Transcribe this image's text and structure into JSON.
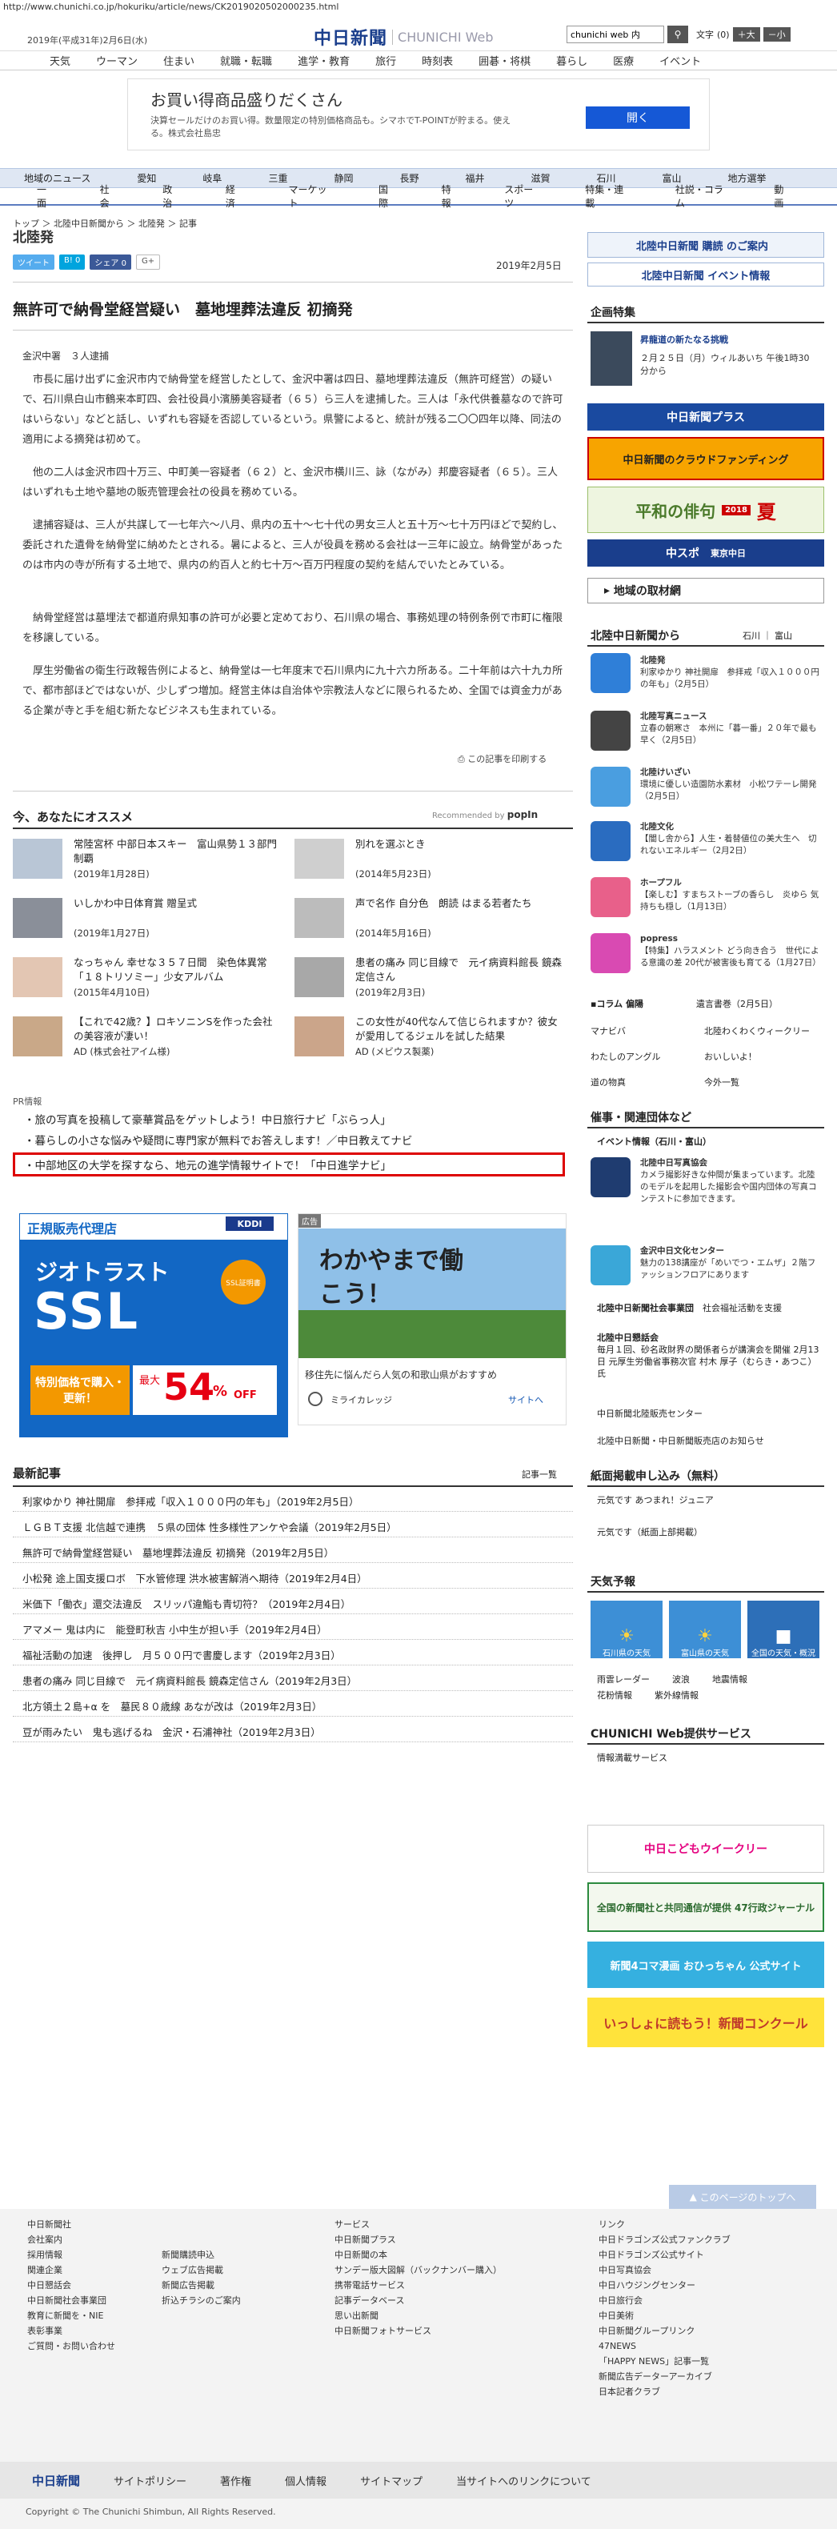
{
  "url": "http://www.chunichi.co.jp/hokuriku/article/news/CK2019020502000235.html",
  "header": {
    "date": "2019年(平成31年)2月6日(水)",
    "logo": "中日新聞",
    "logo_sub": "CHUNICHI Web",
    "search_value": "chunichi web 内",
    "font_label": "文字",
    "font_size": "(0)",
    "font_large": "＋大",
    "font_small": "－小"
  },
  "topnav": [
    "天気",
    "ウーマン",
    "住まい",
    "就職・転職",
    "進学・教育",
    "旅行",
    "時刻表",
    "囲碁・将棋",
    "暮らし",
    "医療",
    "イベント"
  ],
  "top_ad": {
    "title": "お買い得商品盛りだくさん",
    "desc": "決算セールだけのお買い得。数量限定の特別価格商品も。シマホでT-POINTが貯まる。使える。株式会社島忠",
    "btn": "開く"
  },
  "catnav1": [
    "地域のニュース",
    "愛知",
    "岐阜",
    "三重",
    "静岡",
    "長野",
    "福井",
    "滋賀",
    "石川",
    "富山",
    "地方選挙"
  ],
  "catnav2": [
    "一面",
    "社会",
    "政治",
    "経済",
    "マーケット",
    "国際",
    "特報",
    "スポーツ",
    "特集・連載",
    "社説・コラム",
    "動画"
  ],
  "breadcrumb": "トップ ＞ 北陸中日新聞から ＞ 北陸発 ＞ 記事",
  "section": "北陸発",
  "share": {
    "tweet": "ツイート",
    "b": "B! 0",
    "fb": "シェア 0",
    "g": "G+"
  },
  "article": {
    "date": "2019年2月5日",
    "headline": "無許可で納骨堂経営疑い　墓地埋葬法違反 初摘発",
    "byline": "金沢中署　３人逮捕",
    "p1": "市長に届け出ずに金沢市内で納骨堂を経営したとして、金沢中署は四日、墓地埋葬法違反（無許可経営）の疑いで、石川県白山市鶴来本町四、会社役員小濱勝美容疑者（６５）ら三人を逮捕した。三人は「永代供養墓なので許可はいらない」などと話し、いずれも容疑を否認しているという。県警によると、統計が残る二〇〇四年以降、同法の適用による摘発は初めて。",
    "p2": "他の二人は金沢市四十万三、中町美一容疑者（６２）と、金沢市横川三、詠（ながみ）邦慶容疑者（６５）。三人はいずれも土地や墓地の販売管理会社の役員を務めている。",
    "p3": "逮捕容疑は、三人が共謀して一七年六～八月、県内の五十～七十代の男女三人と五十万～七十万円ほどで契約し、委託された遺骨を納骨堂に納めたとされる。暑によると、三人が役員を務める会社は一三年に設立。納骨堂があったのは市内の寺が所有する土地で、県内の約百人と約七十万～百万円程度の契約を結んでいたとみている。",
    "p4": "納骨堂経営は墓埋法で都道府県知事の許可が必要と定めており、石川県の場合、事務処理の特例条例で市町に権限を移譲している。",
    "p5": "厚生労働省の衛生行政報告例によると、納骨堂は一七年度末で石川県内に九十六カ所ある。二十年前は六十九カ所で、都市部ほどではないが、少しずつ増加。経営主体は自治体や宗教法人などに限られるため、全国では資金力がある企業が寺と手を組む新たなビジネスも生まれている。",
    "print": "この記事を印刷する"
  },
  "recommend": {
    "title": "今、あなたにオススメ",
    "by": "Recommended by",
    "brand": "popIn",
    "items": [
      {
        "title": "常陸宮杯 中部日本スキー　富山県勢１３部門制覇",
        "date": "(2019年1月28日)"
      },
      {
        "title": "別れを選ぶとき",
        "date": "(2014年5月23日)"
      },
      {
        "title": "いしかわ中日体育賞 贈呈式",
        "date": "(2019年1月27日)"
      },
      {
        "title": "声で名作 自分色　朗読 はまる若者たち",
        "date": "(2014年5月16日)"
      },
      {
        "title": "なっちゃん 幸せな３５７日間　染色体異常「１８トリソミー」少女アルバム",
        "date": "(2015年4月10日)"
      },
      {
        "title": "患者の痛み 同じ目線で　元イ病資料館長 鏡森定信さん",
        "date": "(2019年2月3日)"
      },
      {
        "title": "【これで42歳？】ロキソニンSを作った会社の美容液が凄い！",
        "date": "AD (株式会社アイム様)"
      },
      {
        "title": "この女性が40代なんて信じられますか？彼女が愛用してるジェルを試した結果",
        "date": "AD (メビウス製薬)"
      }
    ]
  },
  "pr": {
    "label": "PR情報",
    "items": [
      "旅の写真を投稿して豪華賞品をゲットしよう！中日旅行ナビ「ぶらっ人」",
      "暮らしの小さな悩みや疑問に専門家が無料でお答えします！／中日教えてナビ",
      "中部地区の大学を探すなら、地元の進学情報サイトで！「中日進学ナビ」"
    ]
  },
  "ad_ssl": {
    "vendor": "KDDI",
    "title": "正規販売代理店",
    "brand": "ジオトラスト",
    "ssl": "SSL",
    "badge": "SSL証明書",
    "promo": "特別価格で購入・更新！",
    "max": "最大",
    "pct": "54",
    "unit": "%",
    "off": "OFF"
  },
  "ad_wak": {
    "label": "広告",
    "copy": "わかやまで働こう！",
    "desc": "移住先に悩んだら人気の和歌山県がおすすめ",
    "sponsor": "ミライカレッジ",
    "site": "サイトへ"
  },
  "recent": {
    "title": "最新記事",
    "all": "記事一覧",
    "items": [
      "利家ゆかり 神社開扉　参拝戒「収入１０００円の年も」（2019年2月5日）",
      "ＬＧＢＴ支援 北信越で連携　５県の団体 性多様性アンケや会議（2019年2月5日）",
      "無許可で納骨堂経営疑い　墓地埋葬法違反 初摘発（2019年2月5日）",
      "小松発 途上国支援ロボ　下水管修理 洪水被害解消へ期待（2019年2月4日）",
      "米価下「働衣」還交法違反　スリッパ違鮨も青切符？（2019年2月4日）",
      "アマメー 鬼は内に　能登町秋吉 小中生が担い手（2019年2月4日）",
      "福祉活動の加速　後押し　月５００円で書慶します（2019年2月3日）",
      "患者の痛み 同じ目線で　元イ病資料館長 鏡森定信さん（2019年2月3日）",
      "北方領土２島+α を　墓民８０歳線 あなが改は（2019年2月3日）",
      "豆が雨みたい　鬼も逃げるね　金沢・石浦神社（2019年2月3日）"
    ]
  },
  "side": {
    "subscribe": "北陸中日新聞 購読 のご案内",
    "event": "北陸中日新聞 イベント情報",
    "feature_h": "企画特集",
    "feature_title": "昇龍道の新たなる挑戦",
    "feature_desc": "２月２５日（月）ウィルあいち 午後1時30分から",
    "plus": "中日新聞プラス",
    "crowd": "中日新聞のクラウドファンディング",
    "haiku": "平和の俳句",
    "haiku_year": "2018",
    "haiku_season": "夏",
    "chugai": "中スポ",
    "tokyo": "東京中日",
    "local": "地域の取材網",
    "hokuriku_h": "北陸中日新聞から",
    "hokuriku_links": "石川 ｜ 富山",
    "items": [
      {
        "h": "北陸発",
        "d": "利家ゆかり 神社開扉　参拝戒「収入１０００円の年も」（2月5日）"
      },
      {
        "h": "北陸写真ニュース",
        "d": "立春の朝寒さ　本州に「暮一番」２０年で最も早く（2月5日）"
      },
      {
        "h": "北陸けいざい",
        "d": "環境に優しい造園防水素材　小松ワテーレ開発（2月5日）"
      },
      {
        "h": "北陸文化",
        "d": "【闇し舎から】人生・着替値位の美大生へ　切れないエネルギー（2月2日）"
      },
      {
        "h": "ホープフル",
        "d": "【楽しむ】すまちストーブの香らし　炎ゆら 気持ちも穏し（1月13日）"
      },
      {
        "h": "popress",
        "d": "【特集】ハラスメント どう向き合う　世代による意識の差 20代が被害後も育てる（1月27日）"
      }
    ],
    "cols": [
      "コラム 偏陽",
      "遺言書巻（2月5日）",
      "マナビバ",
      "北陸わくわくウィークリー",
      "わたしのアングル",
      "おいしいよ！",
      "道の物真",
      "今外一覧"
    ],
    "sponsor_h": "催事・関連団体など",
    "sponsor_event": "イベント情報（石川・富山）",
    "sponsors": [
      {
        "h": "北陸中日写真協会",
        "d": "カメラ撮影好きな仲間が集まっています。北陸のモデルを起用した撮影会や国内団体の写真コンテストに参加できます。"
      },
      {
        "h": "金沢中日文化センター",
        "d": "魅力の138講座が「めいでつ・エムザ」２階ファッションフロアにあります"
      },
      {
        "h": "北陸中日新聞社会事業団",
        "d": "社会福祉活動を支援"
      },
      {
        "h": "北陸中日懇話会",
        "d": "毎月１回、砂名政財界の関係者らが講演会を開催 2月13日 元厚生労働省事務次官 村木 厚子（むらき・あつこ）氏"
      },
      {
        "h": "中日新聞北陸販売センター",
        "d": ""
      },
      {
        "h": "北陸中日新聞・中日新聞販売店のお知らせ",
        "d": ""
      }
    ],
    "paper_h": "紙面掲載申し込み（無料）",
    "paper_items": [
      "元気です あつまれ！ジュニア",
      "元気です（紙面上部掲載）"
    ],
    "weather_h": "天気予報",
    "weather": [
      "石川県の天気",
      "富山県の天気",
      "全国の天気・概況"
    ],
    "weather_links": [
      "雨雲レーダー",
      "波浪",
      "地震情報",
      "花粉情報",
      "紫外線情報"
    ],
    "svc_h": "CHUNICHI Web提供サービス",
    "svc_item": "情報満載サービス",
    "banners": [
      "中日こどもウイークリー",
      "全国の新聞社と共同通信が提供 47行政ジャーナル",
      "新聞4コマ漫画 おひっちゃん 公式サイト",
      "いっしょに読もう！新聞コンクール"
    ]
  },
  "pagetop": "このページのトップへ",
  "footer": {
    "col1_h": "中日新聞社",
    "col1": [
      "会社案内",
      "採用情報",
      "関連企業",
      "中日懇話会",
      "中日新聞社会事業団",
      "教育に新聞を・NIE",
      "表彰事業",
      "ご質問・お問い合わせ"
    ],
    "col2": [
      "新聞購読申込",
      "ウェブ広告掲載",
      "新聞広告掲載",
      "折込チラシのご案内"
    ],
    "col3_h": "サービス",
    "col3": [
      "中日新聞プラス",
      "中日新聞の本",
      "サンデー版大図解（バックナンバー購入）",
      "携帯電話サービス",
      "記事データベース",
      "思い出新聞",
      "中日新聞フォトサービス"
    ],
    "col4_h": "リンク",
    "col4": [
      "中日ドラゴンズ公式ファンクラブ",
      "中日ドラゴンズ公式サイト",
      "中日写真協会",
      "中日ハウジングセンター",
      "中日旅行会",
      "中日美術",
      "中日新聞グループリンク",
      "47NEWS",
      "「HAPPY NEWS」記事一覧",
      "新聞広告データーアーカイブ",
      "日本記者クラブ"
    ],
    "nav": [
      "中日新聞",
      "サイトポリシー",
      "著作権",
      "個人情報",
      "サイトマップ",
      "当サイトへのリンクについて"
    ],
    "copy": "Copyright © The Chunichi Shimbun, All Rights Reserved."
  }
}
